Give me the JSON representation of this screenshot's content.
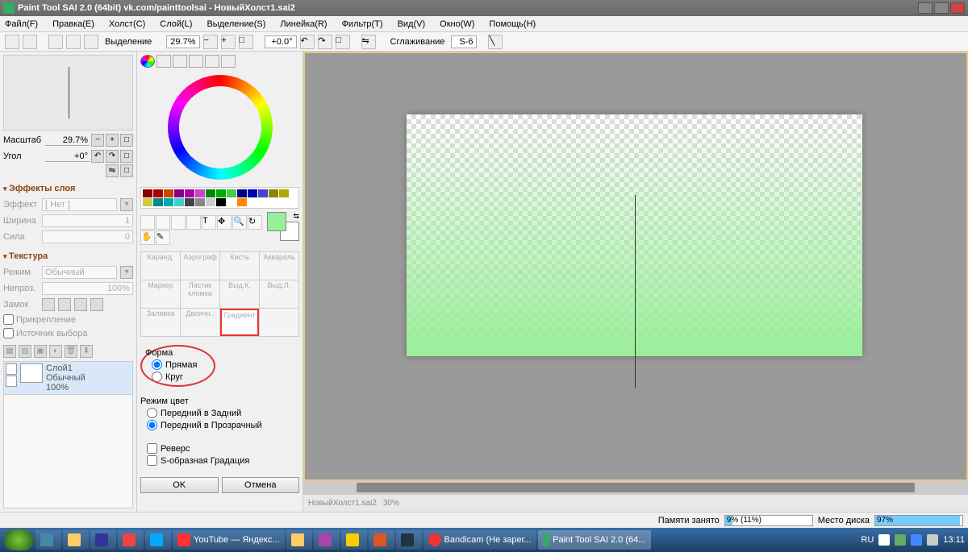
{
  "title": "Paint Tool SAI 2.0 (64bit) vk.com/painttoolsai - НовыйХолст1.sai2",
  "menu": [
    "Файл(F)",
    "Правка(E)",
    "Холст(C)",
    "Слой(L)",
    "Выделение(S)",
    "Линейка(R)",
    "Фильтр(T)",
    "Вид(V)",
    "Окно(W)",
    "Помощь(H)"
  ],
  "toolbar": {
    "selection": "Выделение",
    "zoom": "29.7%",
    "rotation": "+0.0°",
    "smoothing_label": "Сглаживание",
    "smoothing": "S-6"
  },
  "nav": {
    "scale_label": "Масштаб",
    "scale": "29.7%",
    "angle_label": "Угол",
    "angle": "+0°"
  },
  "sections": {
    "effects": "Эффекты слоя",
    "texture": "Текстура"
  },
  "effects": {
    "effect_label": "Эффект",
    "effect_val": "[ Нет ]",
    "width_label": "Ширина",
    "width_val": "1",
    "strength_label": "Сила",
    "strength_val": "0"
  },
  "texture": {
    "mode_label": "Режим",
    "mode_val": "Обычный",
    "opacity_label": "Непроз.",
    "opacity_val": "100%",
    "lock_label": "Замок",
    "pin": "Прикрепление",
    "src": "Источник выбора"
  },
  "layer": {
    "name": "Слой1",
    "mode": "Обычный",
    "opacity": "100%"
  },
  "brushes": [
    "Каранд.",
    "Аэрограф",
    "Кисть",
    "Акварель",
    "Маркер",
    "Ластик кломка",
    "Выд.К.",
    "Выд.Л.",
    "Заливка",
    "Двоичн..",
    "Градиент",
    ""
  ],
  "gradient": {
    "shape_title": "Форма",
    "shape_line": "Прямая",
    "shape_circle": "Круг",
    "mode_title": "Режим цвет",
    "mode_fb": "Передний в Задний",
    "mode_ft": "Передний в Прозрачный",
    "reverse": "Реверс",
    "scurve": "S-образная Градация",
    "ok": "OK",
    "cancel": "Отмена"
  },
  "doctab": {
    "name": "НовыйХолст1.sai2",
    "zoom": "30%"
  },
  "status": {
    "mem_label": "Памяти занято",
    "mem_text": "9% (11%)",
    "mem_pct": 9,
    "disk_label": "Место диска",
    "disk_text": "97%",
    "disk_pct": 97
  },
  "taskbar": {
    "items": [
      "",
      "",
      "",
      "",
      "",
      "YouTube — Яндекс...",
      "",
      "",
      "",
      "",
      "",
      "Bandicam (Не зарег...",
      "Paint Tool SAI 2.0 (64..."
    ],
    "lang": "RU",
    "time": "13:11"
  },
  "swatch_colors": [
    "#800",
    "#a00",
    "#c40",
    "#808",
    "#a0a",
    "#c4c",
    "#080",
    "#0a0",
    "#4c4",
    "#008",
    "#00a",
    "#44c",
    "#880",
    "#aa0",
    "#cc4",
    "#088",
    "#0aa",
    "#4cc",
    "#444",
    "#888",
    "#ccc",
    "#000",
    "#fff",
    "#f80"
  ]
}
